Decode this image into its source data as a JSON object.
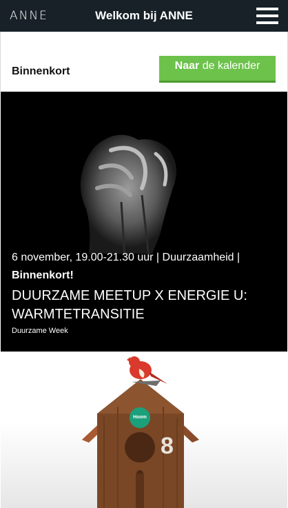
{
  "header": {
    "logo": "ANNE",
    "title": "Welkom bij ANNE"
  },
  "section": {
    "label": "Binnenkort",
    "calendar_button": {
      "bold": "Naar",
      "rest": " de kalender"
    }
  },
  "events": [
    {
      "meta": "6 november, 19.00-21.30 uur | Duurzaamheid |",
      "badge": "Binnenkort!",
      "title": "DUURZAME MEETUP X ENERGIE U: WARMTETRANSITIE",
      "category": "Duurzame Week"
    },
    {
      "badge_text": "Hoom",
      "number": "8"
    }
  ],
  "colors": {
    "topbar": "#172127",
    "accent_green": "#6cc24a",
    "card_bg": "#000000"
  }
}
